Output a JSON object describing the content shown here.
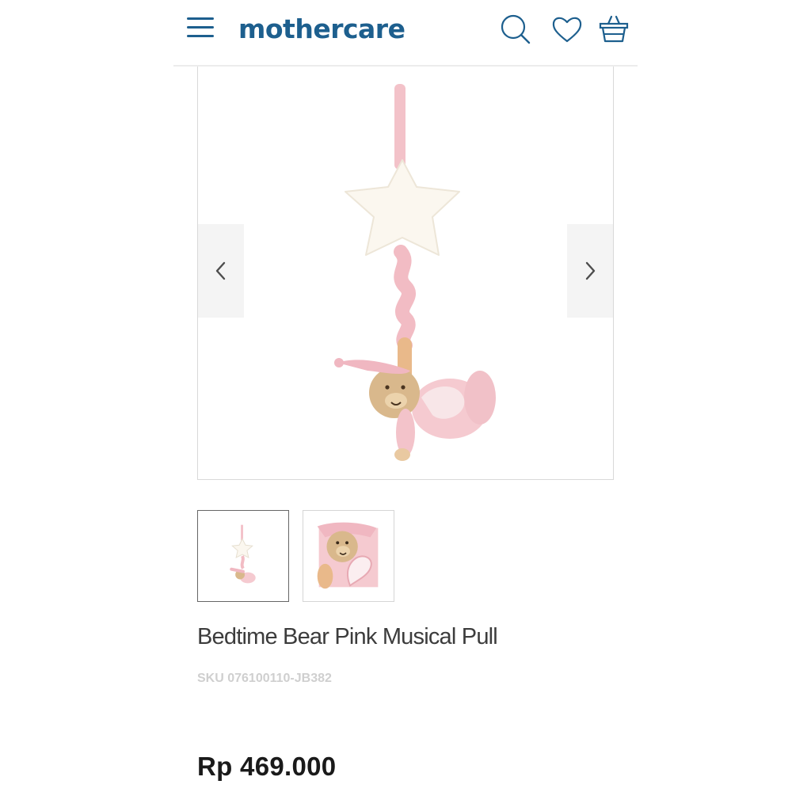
{
  "header": {
    "logo": "mothercare",
    "brand_color": "#1d5f8e",
    "icons": [
      "menu-icon",
      "search-icon",
      "heart-icon",
      "basket-icon"
    ]
  },
  "gallery": {
    "prev_icon": "chevron-left-icon",
    "next_icon": "chevron-right-icon",
    "main_image": "Bedtime bear pink musical pull toy with star",
    "thumbnails": [
      {
        "image": "full product view",
        "active": true
      },
      {
        "image": "close-up of bear face",
        "active": false
      }
    ]
  },
  "product": {
    "title": "Bedtime Bear Pink Musical Pull",
    "sku": "SKU 076100110-JB382",
    "price": "Rp 469.000"
  }
}
